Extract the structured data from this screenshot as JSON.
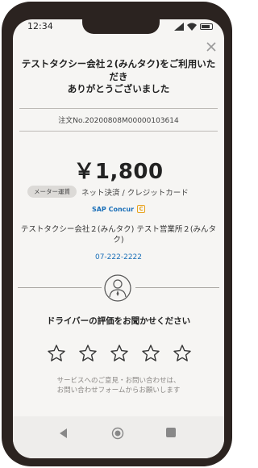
{
  "status_bar": {
    "time": "12:34"
  },
  "header": {
    "thanks_line1": "テストタクシー会社２(みんタク)をご利用いただき",
    "thanks_line2": "ありがとうございました"
  },
  "order": {
    "number_text": "注文No.20200808M00000103614"
  },
  "payment": {
    "amount": "￥1,800",
    "meter_badge": "メーター運賃",
    "method": "ネット決済 / クレジットカード",
    "concur_label": "SAP Concur",
    "concur_icon_letter": "C"
  },
  "company": {
    "name": "テストタクシー会社２(みんタク) テスト営業所２(みんタク)",
    "phone": "07-222-2222"
  },
  "rating": {
    "prompt": "ドライバーの評価をお聞かせください",
    "stars": 5,
    "selected": 0
  },
  "feedback": {
    "line1": "サービスへのご意見・お問い合わせは、",
    "line2": "お問い合わせフォームからお願いします"
  },
  "colors": {
    "phone_frame": "#2b2320",
    "screen_bg": "#f6f5f3",
    "link": "#1a6fb8",
    "concur_accent": "#e8a21d"
  }
}
